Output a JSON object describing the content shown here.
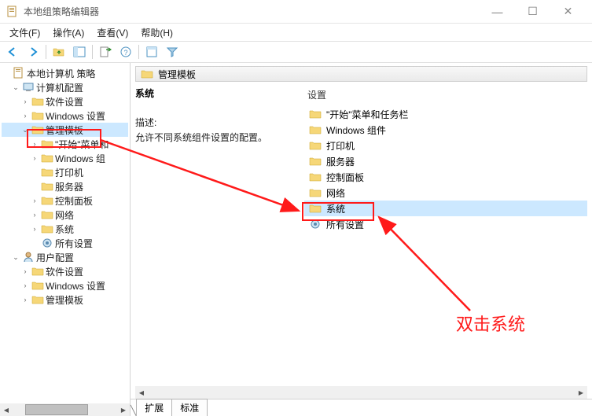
{
  "window": {
    "title": "本地组策略编辑器",
    "min": "—",
    "max": "☐",
    "close": "✕"
  },
  "menu": {
    "file": "文件(F)",
    "action": "操作(A)",
    "view": "查看(V)",
    "help": "帮助(H)"
  },
  "tree": {
    "root": "本地计算机 策略",
    "computer": "计算机配置",
    "software": "软件设置",
    "windows": "Windows 设置",
    "admin": "管理模板",
    "startbar": "\"开始\"菜单和",
    "wincomp": "Windows 组",
    "printer": "打印机",
    "server": "服务器",
    "ctrlpanel": "控制面板",
    "network": "网络",
    "system": "系统",
    "allset": "所有设置",
    "user": "用户配置",
    "u_soft": "软件设置",
    "u_win": "Windows 设置",
    "u_admin": "管理模板"
  },
  "detail": {
    "breadcrumb": "管理模板",
    "title": "系统",
    "desc_label": "描述:",
    "desc_text": "允许不同系统组件设置的配置。",
    "col_header": "设置",
    "items": [
      "\"开始\"菜单和任务栏",
      "Windows 组件",
      "打印机",
      "服务器",
      "控制面板",
      "网络",
      "系统",
      "所有设置"
    ]
  },
  "tabs": {
    "extended": "扩展",
    "standard": "标准"
  },
  "annotation": {
    "text": "双击系统"
  }
}
